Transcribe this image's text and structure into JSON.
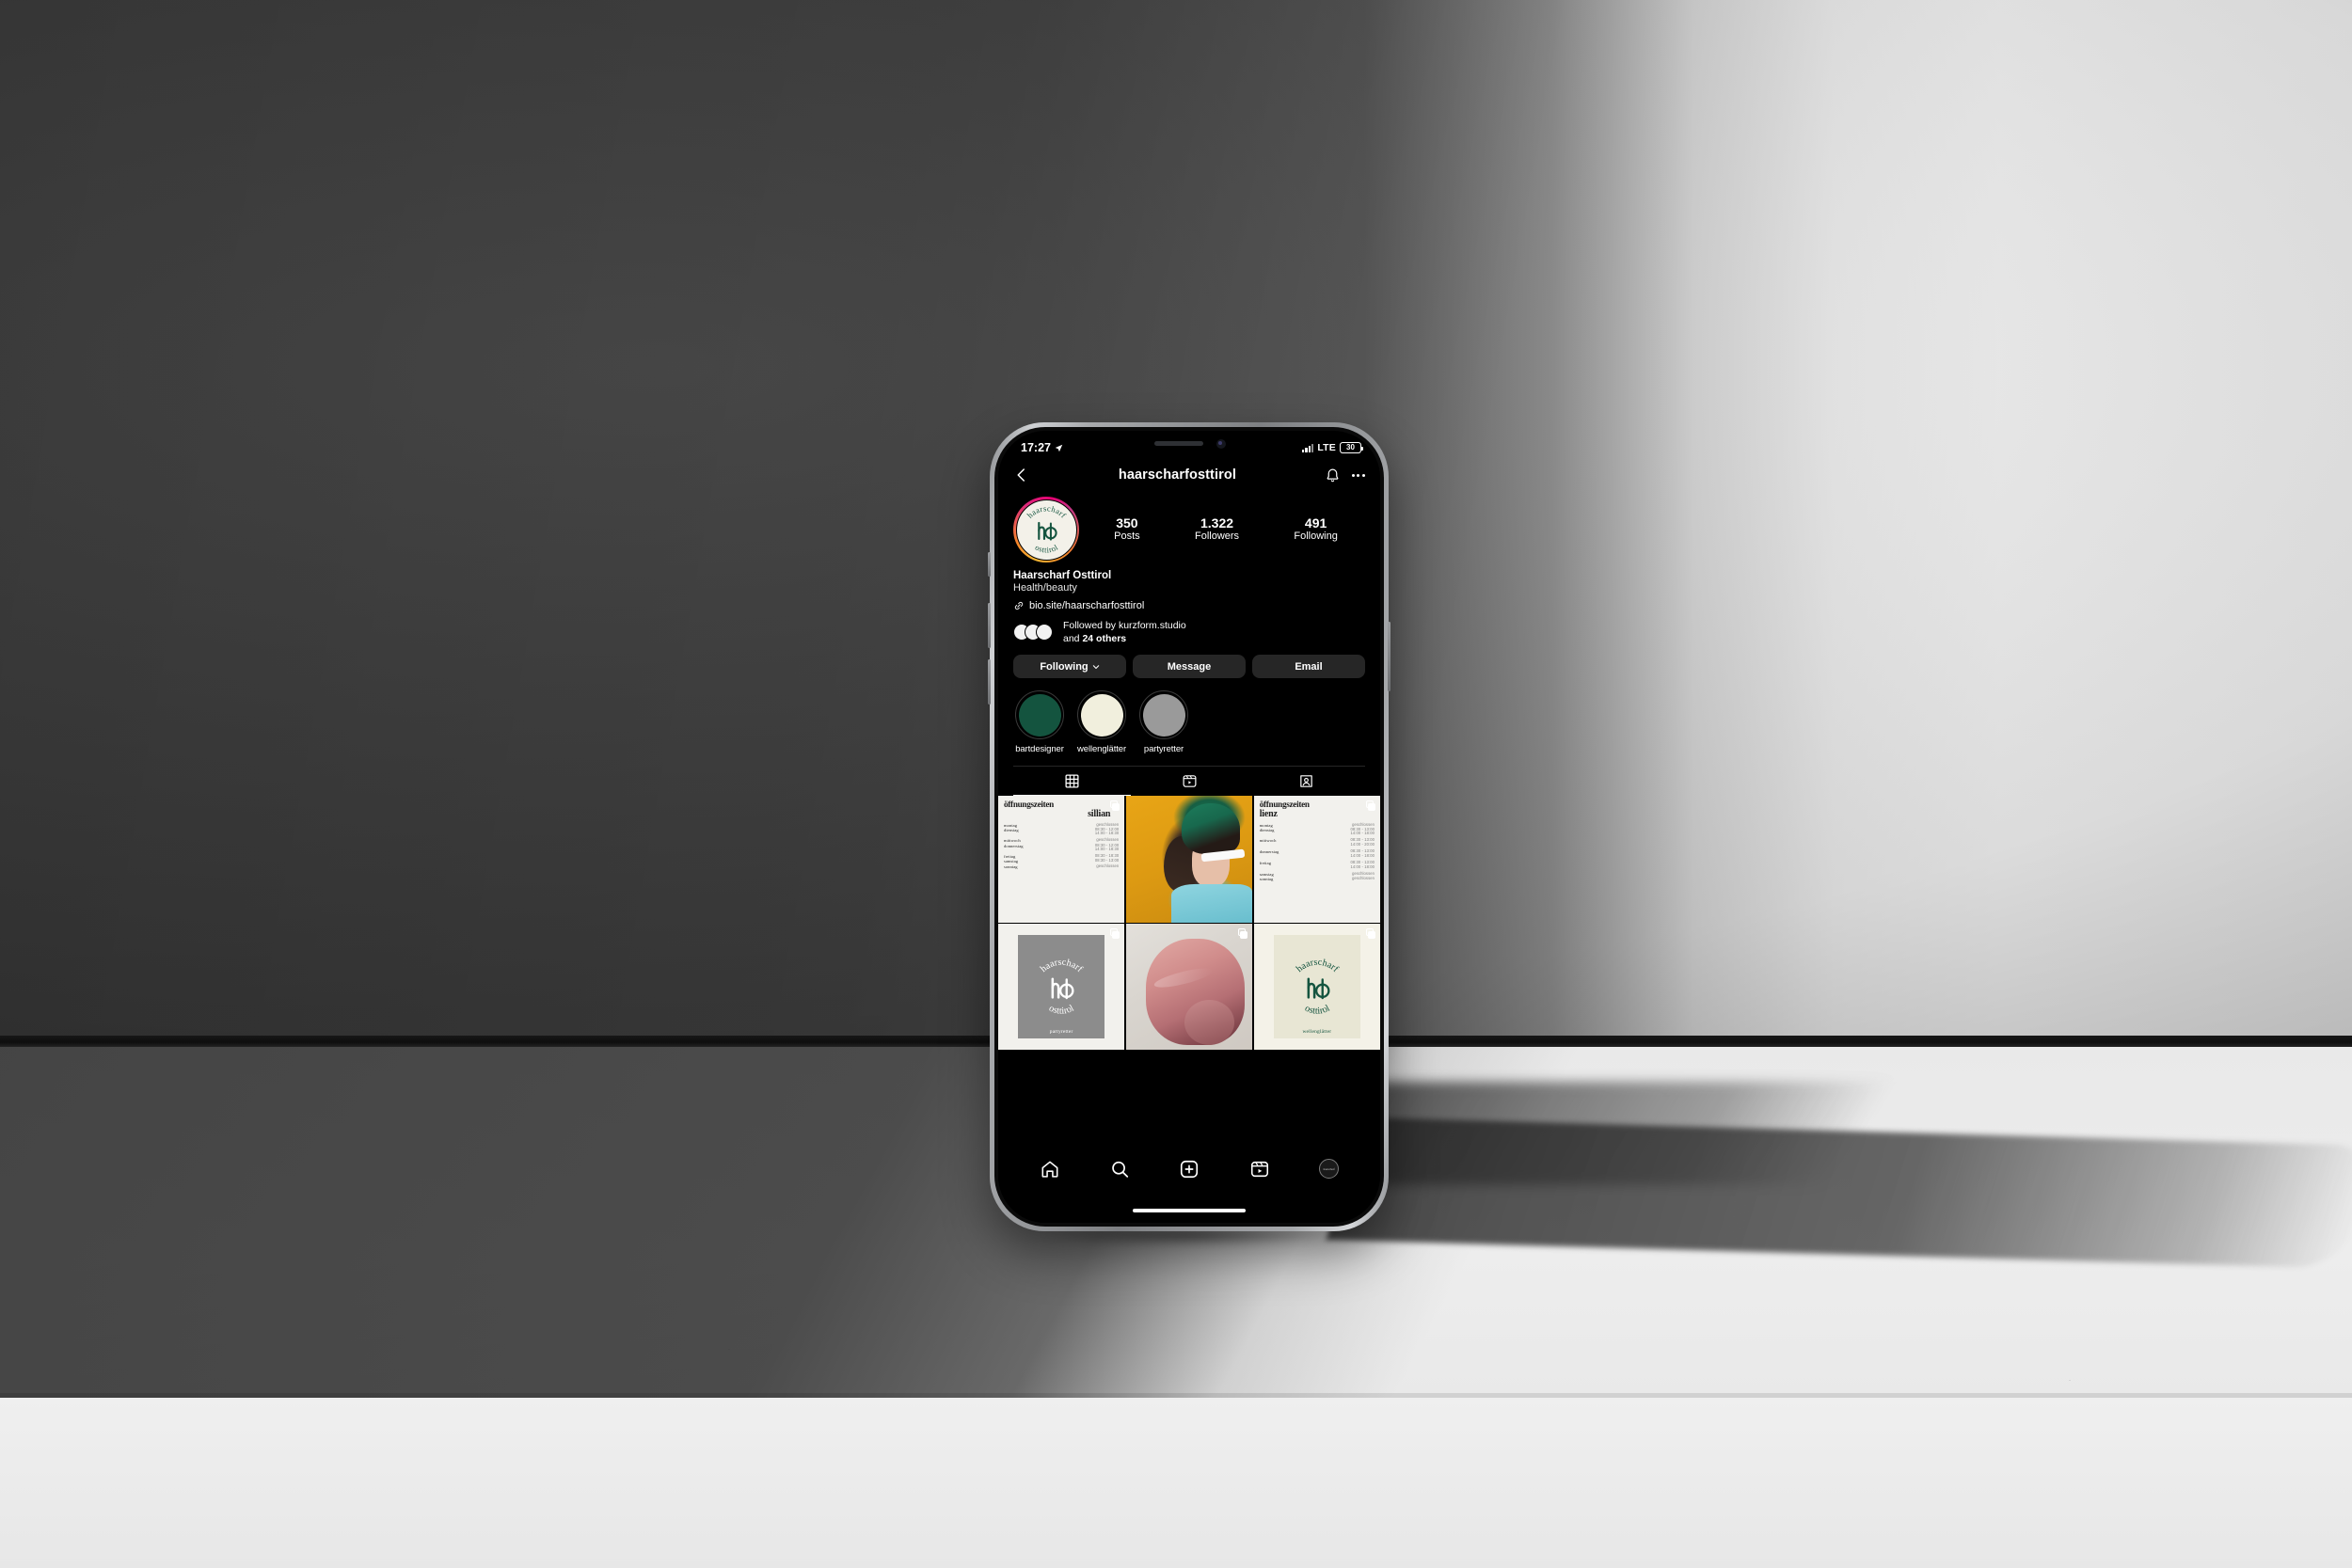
{
  "status_bar": {
    "time": "17:27",
    "location_icon": "location-arrow-icon",
    "signal_icon": "cellular-bars-icon",
    "network": "LTE",
    "battery_level": "30"
  },
  "header": {
    "back_icon": "chevron-left-icon",
    "title": "haarscharfosttirol",
    "notifications_icon": "bell-icon",
    "more_icon": "ellipsis-icon"
  },
  "profile": {
    "avatar_alt": "haarscharf osttirol",
    "logo_top_text": "haarscharf",
    "logo_bottom_text": "osttirol",
    "display_name": "Haarscharf Osttirol",
    "category": "Health/beauty",
    "link_icon": "link-icon",
    "link": "bio.site/haarscharfosttirol",
    "followed_by_prefix": "Followed by ",
    "followed_by_user": "kurzform.studio",
    "followed_by_suffix_pre": "and ",
    "followed_by_count": "24 others",
    "stats": [
      {
        "num": "350",
        "label": "Posts"
      },
      {
        "num": "1.322",
        "label": "Followers"
      },
      {
        "num": "491",
        "label": "Following"
      }
    ],
    "actions": [
      {
        "label": "Following",
        "icon": "chevron-down-icon"
      },
      {
        "label": "Message",
        "icon": ""
      },
      {
        "label": "Email",
        "icon": ""
      }
    ]
  },
  "highlights": [
    {
      "label": "bartdesigner",
      "color": "#14543f"
    },
    {
      "label": "wellenglätter",
      "color": "#f1efdd"
    },
    {
      "label": "partyretter",
      "color": "#9a9a9a"
    }
  ],
  "tabs": [
    {
      "name": "grid-tab",
      "icon": "grid-icon",
      "active": true
    },
    {
      "name": "reels-tab",
      "icon": "reels-icon",
      "active": false
    },
    {
      "name": "tagged-tab",
      "icon": "tagged-icon",
      "active": false
    }
  ],
  "posts": [
    {
      "type": "opening-hours",
      "heading": "öffnungszeiten",
      "location": "sillian",
      "rows": [
        {
          "day": "montag",
          "times": [
            "geschlossen"
          ]
        },
        {
          "day": "dienstag",
          "times": [
            "08:30 - 12:00",
            "14:00 - 18:30"
          ]
        },
        {
          "day": "mittwoch",
          "times": [
            "geschlossen"
          ],
          "gap": true
        },
        {
          "day": "donnerstag",
          "times": [
            "08:30 - 12:00",
            "14:00 - 18:30"
          ]
        },
        {
          "day": "freitag",
          "times": [
            "08:30 - 18:30"
          ],
          "gap": true
        },
        {
          "day": "samstag",
          "times": [
            "08:30 - 13:00"
          ]
        },
        {
          "day": "sonntag",
          "times": [
            "geschlossen"
          ]
        }
      ],
      "carousel": true
    },
    {
      "type": "photo-green",
      "alt": "model with green hair and white sunglasses",
      "carousel": false
    },
    {
      "type": "opening-hours",
      "heading": "öffnungszeiten",
      "location": "lienz",
      "rows": [
        {
          "day": "montag",
          "times": [
            "geschlossen"
          ]
        },
        {
          "day": "dienstag",
          "times": [
            "08:30 - 13:00",
            "14:00 - 18:00"
          ]
        },
        {
          "day": "mittwoch",
          "times": [
            "08:30 - 13:00",
            "14:00 - 20:00"
          ],
          "gap": true
        },
        {
          "day": "donnerstag",
          "times": [
            "08:30 - 13:00",
            "14:00 - 18:00"
          ],
          "gap": true
        },
        {
          "day": "freitag",
          "times": [
            "08:30 - 13:00",
            "14:00 - 18:00"
          ],
          "gap": true
        },
        {
          "day": "samstag",
          "times": [
            "geschlossen"
          ],
          "gap": true
        },
        {
          "day": "sonntag",
          "times": [
            "geschlossen"
          ]
        }
      ],
      "carousel": true
    },
    {
      "type": "stamp-gray",
      "word": "partyretter",
      "carousel": true
    },
    {
      "type": "photo-pink",
      "alt": "rose-pink updo hairstyle",
      "carousel": true
    },
    {
      "type": "stamp-cream",
      "word": "wellenglätter",
      "carousel": true
    }
  ],
  "tabbar": [
    {
      "name": "home",
      "icon": "home-icon"
    },
    {
      "name": "search",
      "icon": "search-icon"
    },
    {
      "name": "create",
      "icon": "plus-square-icon"
    },
    {
      "name": "reels",
      "icon": "reels-icon"
    },
    {
      "name": "profile",
      "icon": "avatar-icon",
      "badge": true
    }
  ],
  "colors": {
    "brand_green": "#14543f",
    "cream": "#f1efdd",
    "ig_dark": "#000000",
    "button_gray": "#262626",
    "badge_red": "#ff2d3e"
  }
}
